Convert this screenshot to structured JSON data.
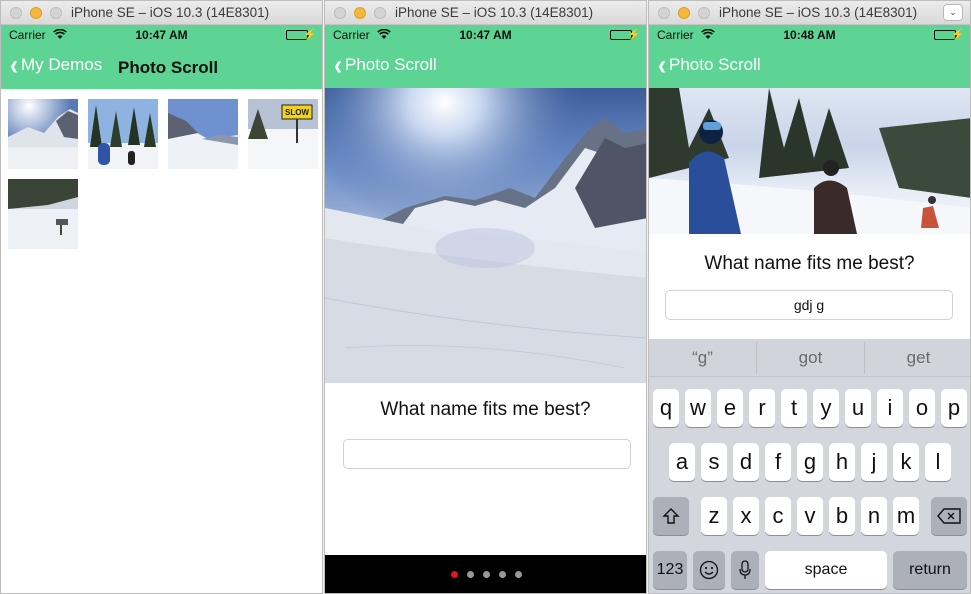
{
  "windows": [
    {
      "title": "iPhone SE – iOS 10.3 (14E8301)",
      "status": {
        "carrier": "Carrier",
        "time": "10:47 AM"
      },
      "nav": {
        "back_label": "My Demos",
        "title": "Photo Scroll"
      }
    },
    {
      "title": "iPhone SE – iOS 10.3 (14E8301)",
      "status": {
        "carrier": "Carrier",
        "time": "10:47 AM"
      },
      "nav": {
        "back_label": "Photo Scroll"
      },
      "question": "What name fits me best?",
      "name_field": {
        "value": ""
      },
      "pager": {
        "count": 5,
        "current": 1
      }
    },
    {
      "title": "iPhone SE – iOS 10.3 (14E8301)",
      "status": {
        "carrier": "Carrier",
        "time": "10:48 AM"
      },
      "nav": {
        "back_label": "Photo Scroll"
      },
      "question": "What name fits me best?",
      "name_field": {
        "value": "gdj g"
      },
      "suggestions": [
        "“g”",
        "got",
        "get"
      ],
      "keyboard": {
        "row1": [
          "q",
          "w",
          "e",
          "r",
          "t",
          "y",
          "u",
          "i",
          "o",
          "p"
        ],
        "row2": [
          "a",
          "s",
          "d",
          "f",
          "g",
          "h",
          "j",
          "k",
          "l"
        ],
        "row3": [
          "z",
          "x",
          "c",
          "v",
          "b",
          "n",
          "m"
        ],
        "numbers_key": "123",
        "space_key": "space",
        "return_key": "return"
      }
    }
  ],
  "thumbnails": [
    {
      "caption_sign": ""
    },
    {
      "caption_sign": ""
    },
    {
      "caption_sign": ""
    },
    {
      "caption_sign": "SLOW"
    },
    {
      "caption_sign": ""
    }
  ],
  "colors": {
    "nav_green": "#5dd394",
    "page_dot_active": "#e0161b",
    "page_dot": "#999999",
    "keyboard_bg": "#d3d6dc"
  }
}
